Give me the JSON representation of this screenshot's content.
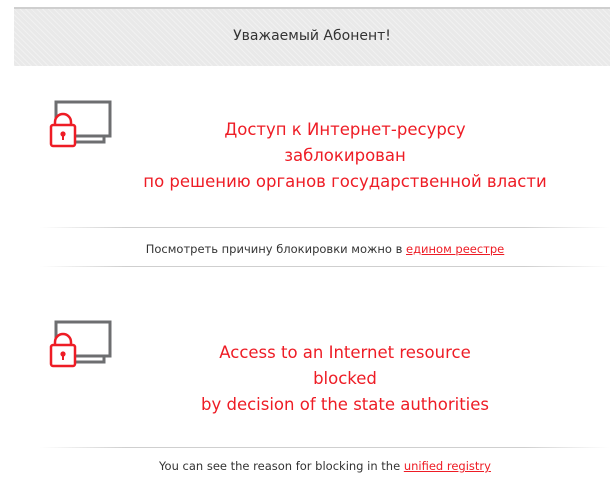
{
  "header": {
    "title": "Уважаемый Абонент!"
  },
  "colors": {
    "accent": "#ee1c25",
    "icon_gray": "#6d6e70",
    "header_bg": "#e9e9e9"
  },
  "ru": {
    "icon": "locked-computer-icon",
    "message_lines": [
      "Доступ к Интернет-ресурсу",
      "заблокирован",
      "по решению органов государственной власти"
    ],
    "reason_text": "Посмотреть причину блокировки можно в ",
    "reason_link": "едином реестре"
  },
  "en": {
    "icon": "locked-computer-icon",
    "message_lines": [
      "Access to an Internet resource",
      "blocked",
      "by decision of the state authorities"
    ],
    "reason_text": "You can see the reason for blocking in the ",
    "reason_link": "unified registry"
  }
}
